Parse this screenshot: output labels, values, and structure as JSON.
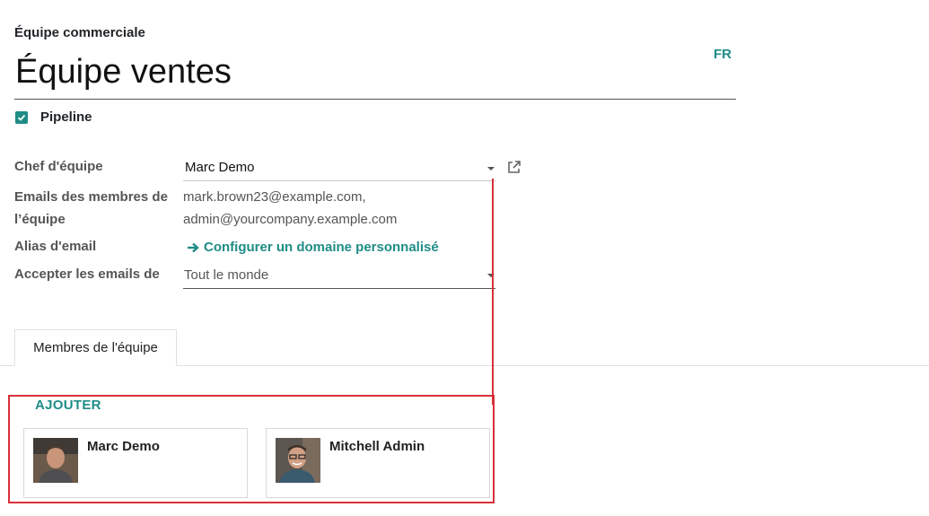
{
  "header": {
    "subtitle": "Équipe commerciale",
    "title": "Équipe ventes",
    "lang": "FR"
  },
  "pipeline": {
    "label": "Pipeline",
    "checked": true
  },
  "fields": {
    "manager": {
      "label": "Chef d'équipe",
      "value": "Marc Demo"
    },
    "emails": {
      "label": "Emails des membres de l’équipe",
      "values": [
        "mark.brown23@example.com,",
        "admin@yourcompany.example.com"
      ]
    },
    "alias": {
      "label": "Alias d'email",
      "link": "Configurer un domaine personnalisé"
    },
    "accept": {
      "label": "Accepter les emails de",
      "value": "Tout le monde"
    }
  },
  "tabs": [
    {
      "label": "Membres de l'équipe",
      "active": true
    }
  ],
  "members": {
    "add_label": "AJOUTER",
    "items": [
      {
        "name": "Marc Demo",
        "avatar": "marc-demo-avatar"
      },
      {
        "name": "Mitchell Admin",
        "avatar": "mitchell-admin-avatar"
      }
    ]
  },
  "colors": {
    "accent": "#1f8c86",
    "highlight": "#d9303a"
  }
}
